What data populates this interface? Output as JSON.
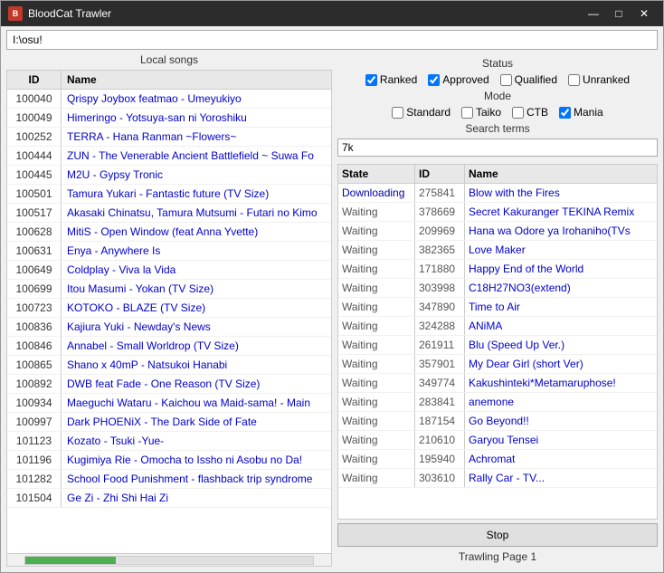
{
  "window": {
    "title": "BloodCat Trawler",
    "address": "I:\\osu!"
  },
  "left_panel": {
    "title": "Local songs",
    "columns": {
      "id": "ID",
      "name": "Name"
    },
    "songs": [
      {
        "id": "100040",
        "name": "Qrispy Joybox featmao - Umeyukiyo"
      },
      {
        "id": "100049",
        "name": "Himeringo - Yotsuya-san ni Yoroshiku"
      },
      {
        "id": "100252",
        "name": "TERRA - Hana Ranman ~Flowers~"
      },
      {
        "id": "100444",
        "name": "ZUN - The Venerable Ancient Battlefield ~ Suwa Fo"
      },
      {
        "id": "100445",
        "name": "M2U - Gypsy Tronic"
      },
      {
        "id": "100501",
        "name": "Tamura Yukari - Fantastic future (TV Size)"
      },
      {
        "id": "100517",
        "name": "Akasaki Chinatsu, Tamura Mutsumi - Futari no Kimo"
      },
      {
        "id": "100628",
        "name": "MitiS - Open Window (feat Anna Yvette)"
      },
      {
        "id": "100631",
        "name": "Enya - Anywhere Is"
      },
      {
        "id": "100649",
        "name": "Coldplay - Viva la Vida"
      },
      {
        "id": "100699",
        "name": "Itou Masumi - Yokan (TV Size)"
      },
      {
        "id": "100723",
        "name": "KOTOKO - BLAZE (TV Size)"
      },
      {
        "id": "100836",
        "name": "Kajiura Yuki - Newday's News"
      },
      {
        "id": "100846",
        "name": "Annabel - Small Worldrop (TV Size)"
      },
      {
        "id": "100865",
        "name": "Shano x 40mP - Natsukoi Hanabi"
      },
      {
        "id": "100892",
        "name": "DWB feat Fade - One Reason (TV Size)"
      },
      {
        "id": "100934",
        "name": "Maeguchi Wataru - Kaichou wa Maid-sama! - Main"
      },
      {
        "id": "100997",
        "name": "Dark PHOENiX - The Dark Side of Fate"
      },
      {
        "id": "101123",
        "name": "Kozato - Tsuki -Yue-"
      },
      {
        "id": "101196",
        "name": "Kugimiya Rie - Omocha to Issho ni Asobu no Da!"
      },
      {
        "id": "101282",
        "name": "School Food Punishment - flashback trip syndrome"
      },
      {
        "id": "101504",
        "name": "Ge Zi - Zhi Shi Hai Zi"
      }
    ]
  },
  "right_panel": {
    "status_title": "Status",
    "mode_title": "Mode",
    "search_title": "Search terms",
    "search_value": "7k",
    "checkboxes": {
      "ranked": {
        "label": "Ranked",
        "checked": true
      },
      "approved": {
        "label": "Approved",
        "checked": true
      },
      "qualified": {
        "label": "Qualified",
        "checked": false
      },
      "unranked": {
        "label": "Unranked",
        "checked": false
      },
      "standard": {
        "label": "Standard",
        "checked": false
      },
      "taiko": {
        "label": "Taiko",
        "checked": false
      },
      "ctb": {
        "label": "CTB",
        "checked": false
      },
      "mania": {
        "label": "Mania",
        "checked": true
      }
    },
    "queue_columns": {
      "state": "State",
      "id": "ID",
      "name": "Name"
    },
    "queue": [
      {
        "state": "Downloading",
        "id": "275841",
        "name": "Blow with the Fires"
      },
      {
        "state": "Waiting",
        "id": "378669",
        "name": "Secret Kakuranger TEKINA Remix"
      },
      {
        "state": "Waiting",
        "id": "209969",
        "name": "Hana wa Odore ya Irohaniho(TVs"
      },
      {
        "state": "Waiting",
        "id": "382365",
        "name": "Love Maker"
      },
      {
        "state": "Waiting",
        "id": "171880",
        "name": "Happy End of the World"
      },
      {
        "state": "Waiting",
        "id": "303998",
        "name": "C18H27NO3(extend)"
      },
      {
        "state": "Waiting",
        "id": "347890",
        "name": "Time to Air"
      },
      {
        "state": "Waiting",
        "id": "324288",
        "name": "ANiMA"
      },
      {
        "state": "Waiting",
        "id": "261911",
        "name": "Blu (Speed Up Ver.)"
      },
      {
        "state": "Waiting",
        "id": "357901",
        "name": "My Dear Girl (short Ver)"
      },
      {
        "state": "Waiting",
        "id": "349774",
        "name": "Kakushinteki*Metamaruphose!"
      },
      {
        "state": "Waiting",
        "id": "283841",
        "name": "anemone"
      },
      {
        "state": "Waiting",
        "id": "187154",
        "name": "Go Beyond!!"
      },
      {
        "state": "Waiting",
        "id": "210610",
        "name": "Garyou Tensei"
      },
      {
        "state": "Waiting",
        "id": "195940",
        "name": "Achromat"
      },
      {
        "state": "Waiting",
        "id": "303610",
        "name": "Rally Car - TV..."
      }
    ],
    "stop_btn_label": "Stop",
    "trawling_status": "Trawling Page 1"
  },
  "icons": {
    "minimize": "—",
    "maximize": "□",
    "close": "✕"
  }
}
